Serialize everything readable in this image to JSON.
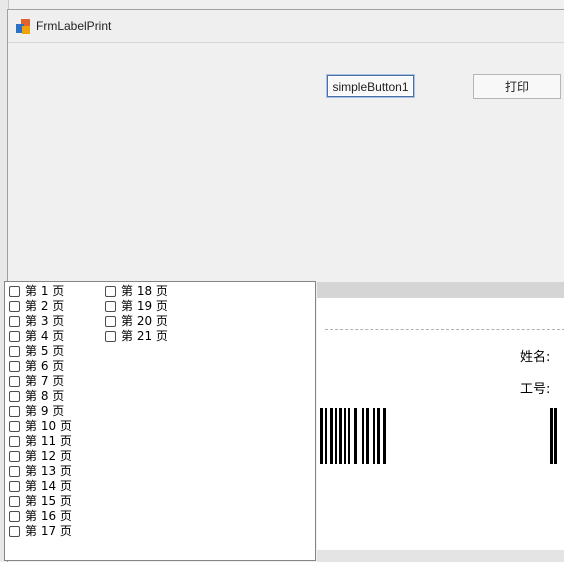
{
  "window": {
    "title": "FrmLabelPrint"
  },
  "toolbar": {
    "simple_button_label": "simpleButton1",
    "print_label": "打印"
  },
  "preview": {
    "name_label": "姓名:",
    "id_label": "工号:"
  },
  "page_list": {
    "column1": [
      "第 1 页",
      "第 2 页",
      "第 3 页",
      "第 4 页",
      "第 5 页",
      "第 6 页",
      "第 7 页",
      "第 8 页",
      "第 9 页",
      "第 10 页",
      "第 11 页",
      "第 12 页",
      "第 13 页",
      "第 14 页",
      "第 15 页",
      "第 16 页",
      "第 17 页"
    ],
    "column2": [
      "第 18 页",
      "第 19 页",
      "第 20 页",
      "第 21 页"
    ]
  },
  "colors": {
    "title_bar": "#efefef",
    "window_bg": "#f0f0f0",
    "focus_border": "#4a6fa5",
    "checkbox_border": "#4d4d4d"
  }
}
